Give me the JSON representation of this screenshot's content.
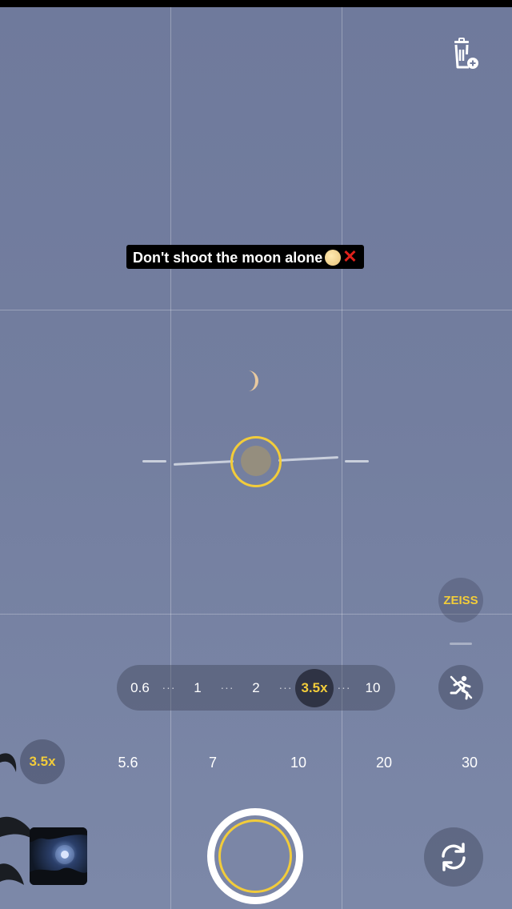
{
  "caption": {
    "text": "Don't shoot the moon alone"
  },
  "zeiss": {
    "label": "ZEISS"
  },
  "zoom_bar": {
    "levels": [
      "0.6",
      "1",
      "2",
      "3.5x",
      "10"
    ],
    "active": "3.5x",
    "separator": "···"
  },
  "focal_lengths": {
    "active": "3.5x",
    "items": [
      "5.6",
      "7",
      "10",
      "20",
      "30"
    ]
  },
  "icons": {
    "top_right": "trash-plus-icon",
    "motion": "motion-off-icon",
    "flip": "switch-camera-icon"
  },
  "colors": {
    "accent": "#f2cc3a",
    "caption_bg": "#000000"
  }
}
